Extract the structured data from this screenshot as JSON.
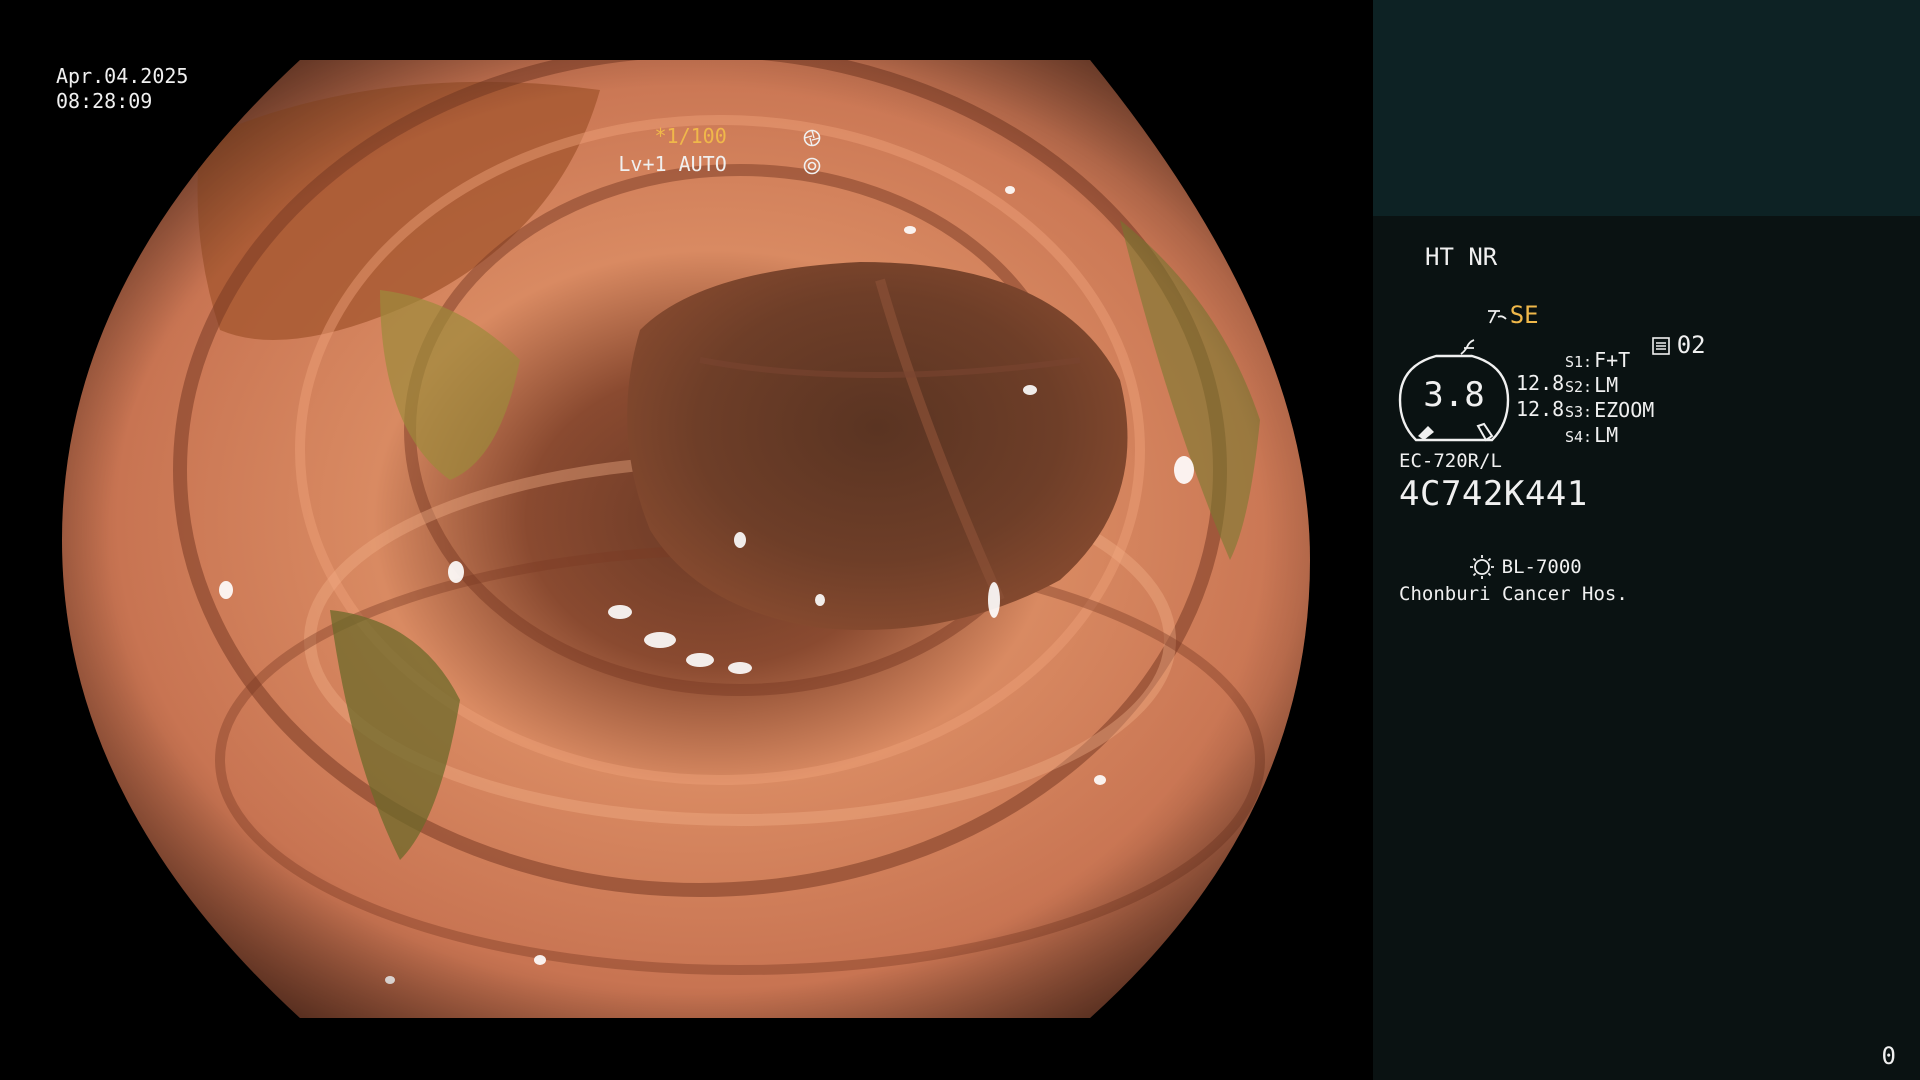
{
  "video": {
    "date": "Apr.04.2025",
    "time": "08:28:09",
    "shutter": "*1/100",
    "shutter_icon": "aperture-icon",
    "iris": "Lv+1 AUTO",
    "iris_icon": "iris-icon"
  },
  "panel": {
    "mode": "HT NR",
    "structure_enhancement": "SE",
    "structure_icon": "structure-enhance-icon",
    "freeze_icon": "freeze-icon",
    "zoom_icon": "zoom-level-icon",
    "zoom_level": "02",
    "gauge_value": "3.8",
    "enhance_values": [
      "12.8",
      "12.8"
    ],
    "switches": [
      {
        "key": "S1:",
        "value": "F+T"
      },
      {
        "key": "S2:",
        "value": "LM"
      },
      {
        "key": "S3:",
        "value": "EZOOM"
      },
      {
        "key": "S4:",
        "value": "LM"
      }
    ],
    "scope_model": "EC-720R/L",
    "serial": "4C742K441",
    "light_source_icon": "lamp-icon",
    "light_source": "BL-7000",
    "hospital": "Chonburi Cancer Hos.",
    "counter": "0"
  },
  "colors": {
    "accent_yellow": "#f0b84a",
    "panel_bg": "#0a1212",
    "panel_top_bg": "#0d2224",
    "text": "#f0f0f0"
  }
}
